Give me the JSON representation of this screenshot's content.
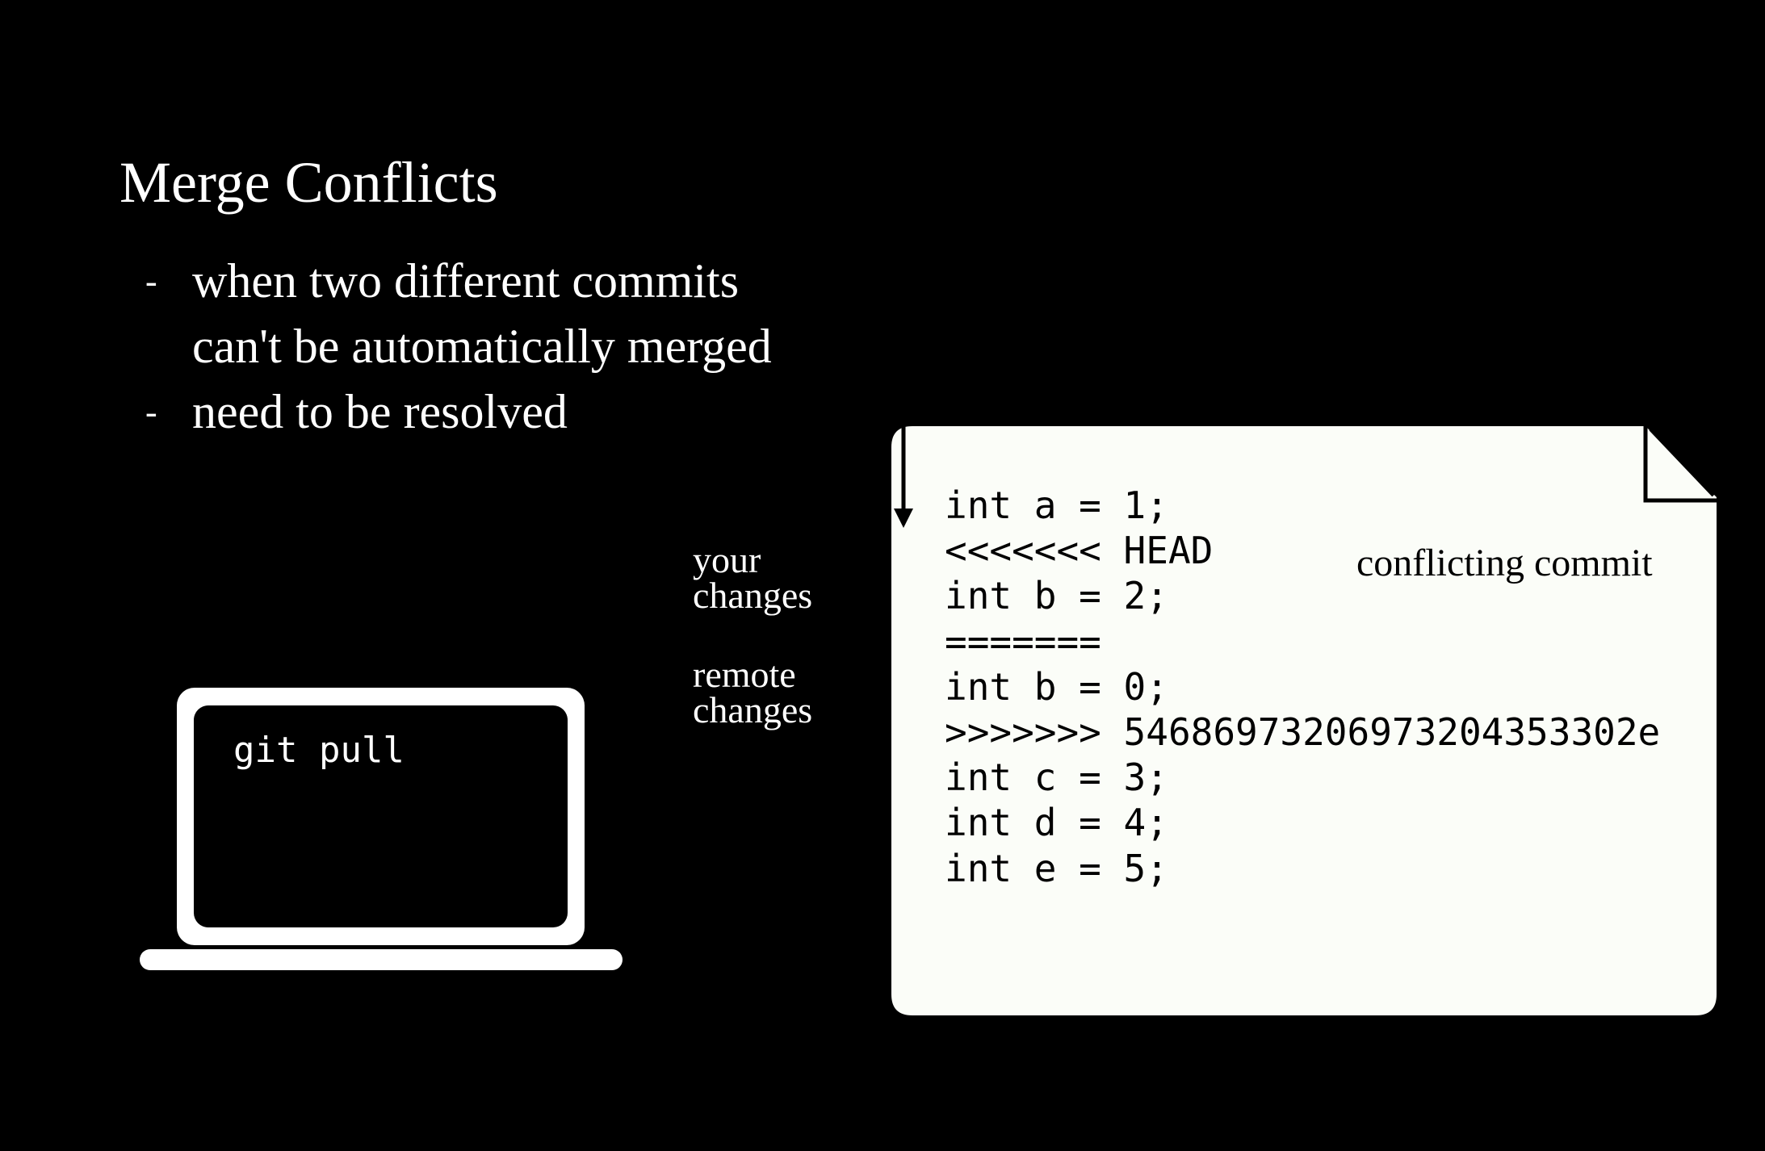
{
  "title": "Merge Conflicts",
  "bullets": [
    {
      "lines": [
        "when two different commits",
        "can't be automatically merged"
      ]
    },
    {
      "lines": [
        "need to be resolved"
      ]
    }
  ],
  "bullet_marker": "-",
  "laptop": {
    "command": "git pull"
  },
  "labels": {
    "your_changes": [
      "your",
      "changes"
    ],
    "remote_changes": [
      "remote",
      "changes"
    ],
    "brace": "{"
  },
  "file": {
    "lines": [
      "int a = 1;",
      "<<<<<<< HEAD",
      "int b = 2;",
      "=======",
      "int b = 0;",
      ">>>>>>> 54686973206973204353302e",
      "int c = 3;",
      "int d = 4;",
      "int e = 5;"
    ],
    "annotation": "conflicting commit"
  },
  "colors": {
    "background": "#000000",
    "foreground": "#ffffff",
    "paper": "#fbfdf8",
    "ink": "#000000"
  }
}
